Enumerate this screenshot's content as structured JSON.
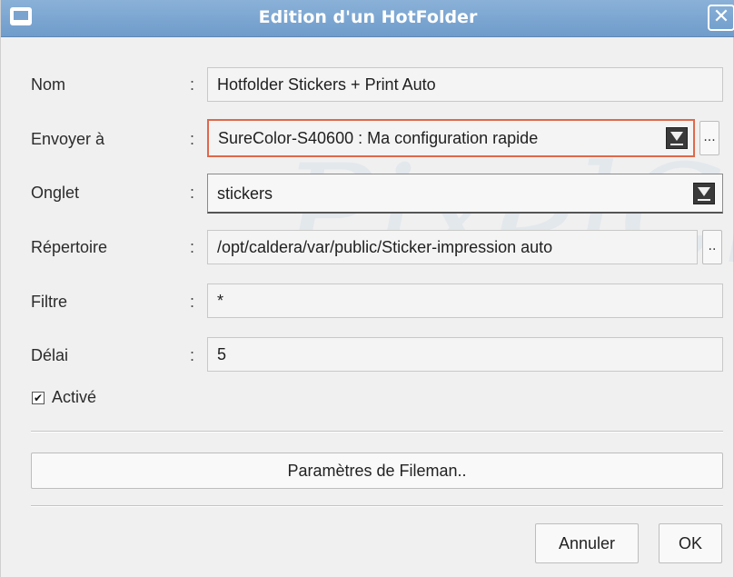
{
  "window": {
    "title": "Edition d'un HotFolder",
    "close_glyph": "✕"
  },
  "watermark": "PixelCleo",
  "form": {
    "nom": {
      "label": "Nom",
      "value": "Hotfolder Stickers + Print Auto"
    },
    "envoyer": {
      "label": "Envoyer à",
      "value": "SureColor-S40600 : Ma configuration rapide",
      "browse": "..."
    },
    "onglet": {
      "label": "Onglet",
      "value": "stickers"
    },
    "repertoire": {
      "label": "Répertoire",
      "value": "/opt/caldera/var/public/Sticker-impression auto",
      "browse": ".."
    },
    "filtre": {
      "label": "Filtre",
      "value": "*"
    },
    "delai": {
      "label": "Délai",
      "value": "5"
    },
    "colon": ":"
  },
  "active": {
    "label": "Activé",
    "checked": true,
    "mark": "✔"
  },
  "buttons": {
    "fileman": "Paramètres de Fileman..",
    "cancel": "Annuler",
    "ok": "OK"
  },
  "colors": {
    "titlebar": "#7aa3cf",
    "focus_border": "#e0684a"
  }
}
